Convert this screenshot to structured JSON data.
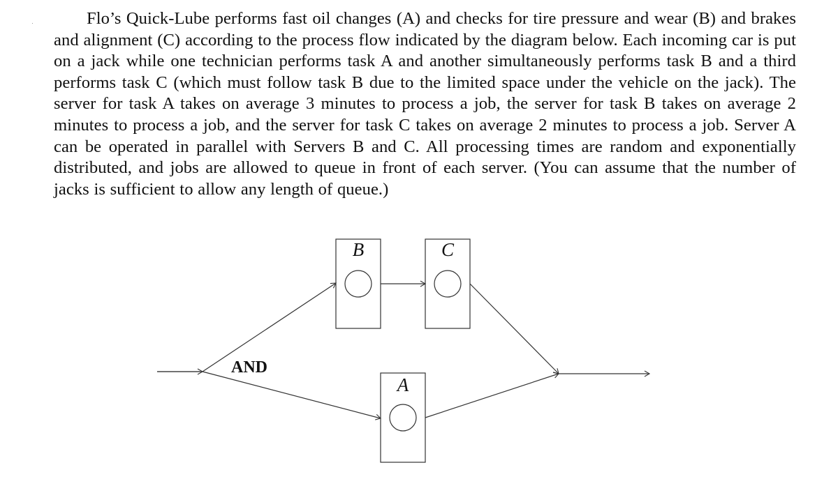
{
  "problem": {
    "paragraph": "Flo’s Quick-Lube performs fast oil changes (A) and checks for tire pressure and wear (B) and brakes and alignment (C) according to the process flow indicated by the diagram below. Each incoming car is put on a jack while one technician performs task A and another simultaneously performs task B and a third performs task C (which must follow task B due to the limited space under the vehicle on the jack). The server for task A takes on average 3 minutes to process a job, the server for task B takes on average 2 minutes to process a job, and the server for task C takes on average 2 minutes to process a job. Server A can be operated in parallel with Servers B and C. All processing times are random and exponentially distributed, and jobs are allowed to queue in front of each server. (You can assume that the number of jacks is sufficient to allow any length of queue.)"
  },
  "diagram": {
    "split_label": "AND",
    "servers": [
      {
        "id": "B",
        "label": "B"
      },
      {
        "id": "C",
        "label": "C"
      },
      {
        "id": "A",
        "label": "A"
      }
    ],
    "edges": [
      {
        "from": "input",
        "to": "split"
      },
      {
        "from": "split",
        "to": "B"
      },
      {
        "from": "B",
        "to": "C"
      },
      {
        "from": "C",
        "to": "merge"
      },
      {
        "from": "split",
        "to": "A"
      },
      {
        "from": "A",
        "to": "merge"
      },
      {
        "from": "merge",
        "to": "output"
      }
    ],
    "line_color": "#333333"
  }
}
